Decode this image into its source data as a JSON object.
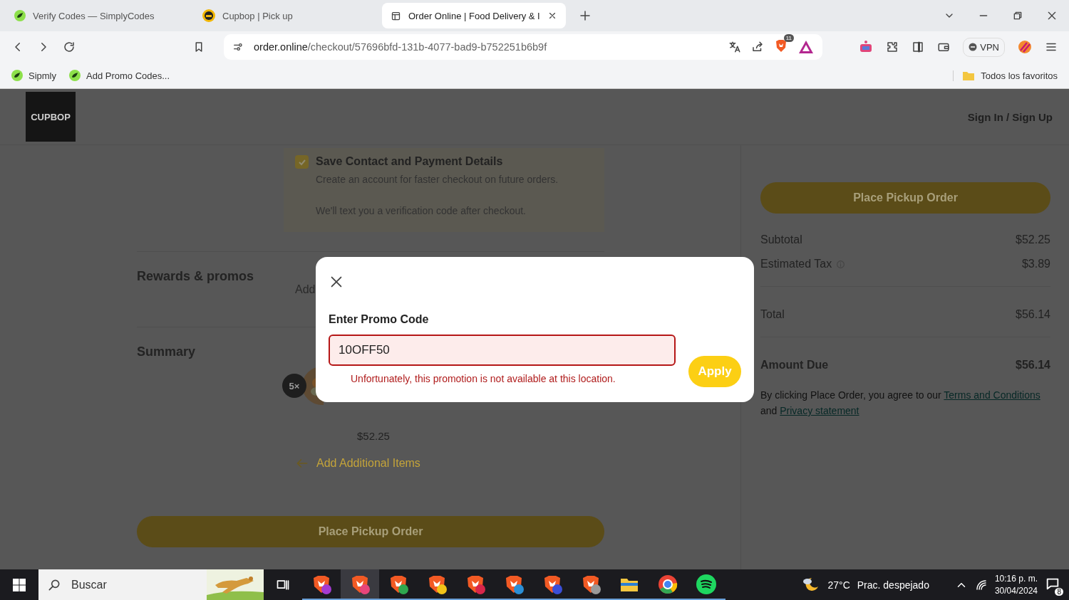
{
  "browser": {
    "tabs": [
      {
        "title": "Verify Codes — SimplyCodes",
        "kind": "simply",
        "selected": false
      },
      {
        "title": "Cupbop | Pick up",
        "kind": "cupbop",
        "selected": false
      },
      {
        "title": "Order Online | Food Delivery & I",
        "kind": "page",
        "selected": true
      }
    ],
    "url_host": "order.online",
    "url_path": "/checkout/57696bfd-131b-4077-bad9-b752251b6b9f",
    "shields_badge": "11",
    "vpn": "VPN",
    "bookmarks": [
      "Sipmly",
      "Add Promo Codes..."
    ],
    "bookmarks_folder": "Todos los favoritos"
  },
  "header": {
    "logo": "CUPBOP",
    "sign_in": "Sign In / Sign Up"
  },
  "save_details": {
    "checked": true,
    "title": "Save Contact and Payment Details",
    "lines": [
      "Create an account for faster checkout on future orders.",
      "We'll text you a verification code after checkout."
    ]
  },
  "rewards": {
    "heading": "Rewards & promos",
    "action": "Add"
  },
  "summary": {
    "heading": "Summary",
    "quantity": "5×",
    "price": "$52.25",
    "add_items": "Add Additional Items"
  },
  "main_button": "Place Pickup Order",
  "totals": {
    "button": "Place Pickup Order",
    "rows": [
      {
        "label": "Subtotal",
        "value": "$52.25",
        "info": false,
        "divider": false
      },
      {
        "label": "Estimated Tax",
        "value": "$3.89",
        "info": true,
        "divider": true
      },
      {
        "label": "Total",
        "value": "$56.14",
        "info": false,
        "divider": true
      }
    ],
    "amount_due": {
      "label": "Amount Due",
      "value": "$56.14"
    },
    "legal": {
      "text": "By clicking Place Order, you agree to our",
      "link1": "Terms and Conditions",
      "middle": "and",
      "link2": "Privacy statement"
    }
  },
  "modal": {
    "title": "Enter Promo Code",
    "value": "10OFF50",
    "invalid": true,
    "error": "Unfortunately, this promotion is not available at this location.",
    "apply": "Apply"
  },
  "taskbar": {
    "search_placeholder": "Buscar",
    "weather": "27°C",
    "weather_text": "Prac. despejado",
    "time": "10:16 p. m.",
    "date": "30/04/2024",
    "notifications": "8",
    "apps": [
      {
        "kind": "brave",
        "color": "#a43bd1",
        "selected": false
      },
      {
        "kind": "brave",
        "color": "#e8457a",
        "selected": true
      },
      {
        "kind": "brave",
        "color": "#2fa84f",
        "selected": false
      },
      {
        "kind": "brave",
        "color": "#f2c318",
        "selected": false
      },
      {
        "kind": "brave",
        "color": "#d8264a",
        "selected": false
      },
      {
        "kind": "brave",
        "color": "#2b8fd6",
        "selected": false
      },
      {
        "kind": "brave",
        "color": "#3b4fd8",
        "selected": false
      },
      {
        "kind": "brave",
        "color": "#9a9a9a",
        "selected": false
      },
      {
        "kind": "folder",
        "color": "#f3c640",
        "selected": false
      },
      {
        "kind": "chrome",
        "color": "#ea4335",
        "selected": false
      },
      {
        "kind": "spotify",
        "color": "#1ed760",
        "selected": false
      }
    ]
  }
}
